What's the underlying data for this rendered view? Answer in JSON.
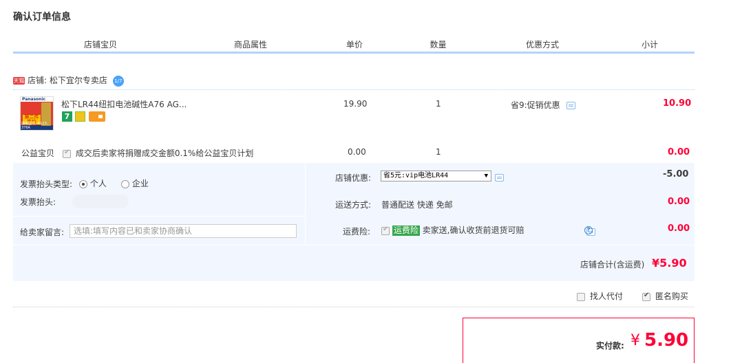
{
  "page_title": "确认订单信息",
  "columns": [
    "店铺宝贝",
    "商品属性",
    "单价",
    "数量",
    "优惠方式",
    "小计"
  ],
  "shop": {
    "badge": "天猫",
    "label": "店铺: 松下宜尔专卖店",
    "ww_badge": "1/7"
  },
  "product": {
    "image_brand": "Panasonic",
    "image_sticker": "第二件半价",
    "image_footer": "通用型号: AG13、376A",
    "name": "松下LR44纽扣电池碱性A76 AG...",
    "tag_seven": "7",
    "price": "19.90",
    "quantity": "1",
    "promo": "省9:促销优惠",
    "subtotal": "10.90"
  },
  "charity": {
    "label": "公益宝贝",
    "text": "成交后卖家将捐赠成交金额0.1%给公益宝贝计划",
    "price": "0.00",
    "quantity": "1",
    "subtotal": "0.00"
  },
  "invoice": {
    "type_label": "发票抬头类型:",
    "option_personal": "个人",
    "option_company": "企业",
    "selected": "个人",
    "title_label": "发票抬头:"
  },
  "message": {
    "label": "给卖家留言:",
    "placeholder": "选填:填写内容已和卖家协商确认"
  },
  "shop_discount": {
    "label": "店铺优惠:",
    "selected": "省5元:vip电池LR44",
    "amount": "-5.00"
  },
  "shipping": {
    "label": "运送方式:",
    "value": "普通配送 快递 免邮",
    "amount": "0.00"
  },
  "freight_insurance": {
    "label": "运费险:",
    "badge": "运费险",
    "text": "卖家送,确认收货前退货可赔",
    "amount": "0.00"
  },
  "shop_total": {
    "label": "店铺合计(含运费)",
    "amount": "¥5.90"
  },
  "options": {
    "proxy_pay": "找人代付",
    "anonymous": "匿名购买"
  },
  "payment": {
    "label": "实付款:",
    "currency": "¥",
    "amount": "5.90"
  },
  "colors": {
    "accent_red": "#ff0036",
    "header_blue_line": "#b2d1ff",
    "panel_bg": "#f2f7ff",
    "insurance_green": "#35a64b"
  }
}
